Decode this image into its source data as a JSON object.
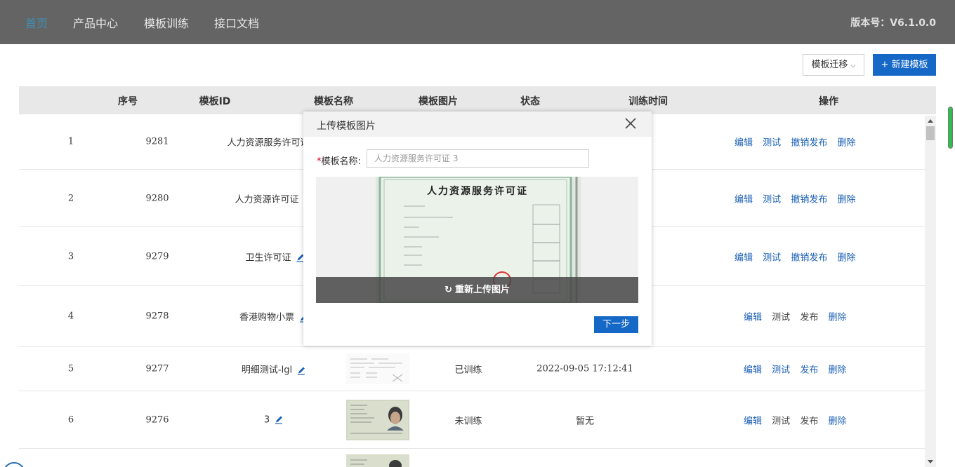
{
  "nav": {
    "items": [
      "首页",
      "产品中心",
      "模板训练",
      "接口文档"
    ],
    "version": "版本号：V6.1.0.0"
  },
  "toolbar": {
    "migrate_label": "模板迁移",
    "new_label": "+ 新建模板"
  },
  "table": {
    "headers": [
      "序号",
      "模板ID",
      "模板名称",
      "模板图片",
      "状态",
      "训练时间",
      "操作"
    ],
    "rows": [
      {
        "index": "1",
        "id": "9281",
        "name": "人力资源服务许可证",
        "status": "",
        "time": "",
        "ops": [
          "编辑",
          "测试",
          "撤销发布",
          "删除"
        ]
      },
      {
        "index": "2",
        "id": "9280",
        "name": "人力资源许可证",
        "status": "",
        "time": "",
        "ops": [
          "编辑",
          "测试",
          "撤销发布",
          "删除"
        ]
      },
      {
        "index": "3",
        "id": "9279",
        "name": "卫生许可证",
        "status": "",
        "time": "",
        "ops": [
          "编辑",
          "测试",
          "撤销发布",
          "删除"
        ]
      },
      {
        "index": "4",
        "id": "9278",
        "name": "香港购物小票",
        "status": "",
        "time": "",
        "ops": [
          "编辑",
          "测试",
          "发布",
          "删除"
        ]
      },
      {
        "index": "5",
        "id": "9277",
        "name": "明细测试-lgl",
        "status": "已训练",
        "time": "2022-09-05 17:12:41",
        "ops": [
          "编辑",
          "测试",
          "发布",
          "删除"
        ]
      },
      {
        "index": "6",
        "id": "9276",
        "name": "3",
        "status": "未训练",
        "time": "暂无",
        "ops": [
          "编辑",
          "测试",
          "发布",
          "删除"
        ]
      }
    ]
  },
  "modal": {
    "title": "上传模板图片",
    "field_label": "模板名称:",
    "field_required": "*",
    "field_value": "人力资源服务许可证 3",
    "preview_title": "人力资源服务许可证",
    "reupload_label": "重新上传图片",
    "next_label": "下一步"
  },
  "colors": {
    "nav_bg": "#646464",
    "nav_active": "#3f8fb0",
    "primary": "#1668c6",
    "link": "#1a5fb4"
  }
}
